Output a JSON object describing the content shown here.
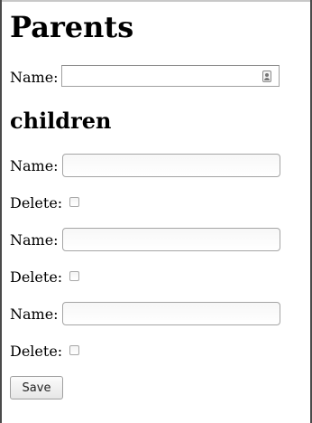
{
  "parents": {
    "heading": "Parents",
    "name_label": "Name:",
    "name_value": ""
  },
  "children": {
    "heading": "children",
    "rows": [
      {
        "name_label": "Name:",
        "name_value": "",
        "delete_label": "Delete:",
        "delete_checked": false
      },
      {
        "name_label": "Name:",
        "name_value": "",
        "delete_label": "Delete:",
        "delete_checked": false
      },
      {
        "name_label": "Name:",
        "name_value": "",
        "delete_label": "Delete:",
        "delete_checked": false
      }
    ]
  },
  "actions": {
    "save_label": "Save"
  },
  "icons": {
    "parent_name_field": "contact-card-icon"
  }
}
